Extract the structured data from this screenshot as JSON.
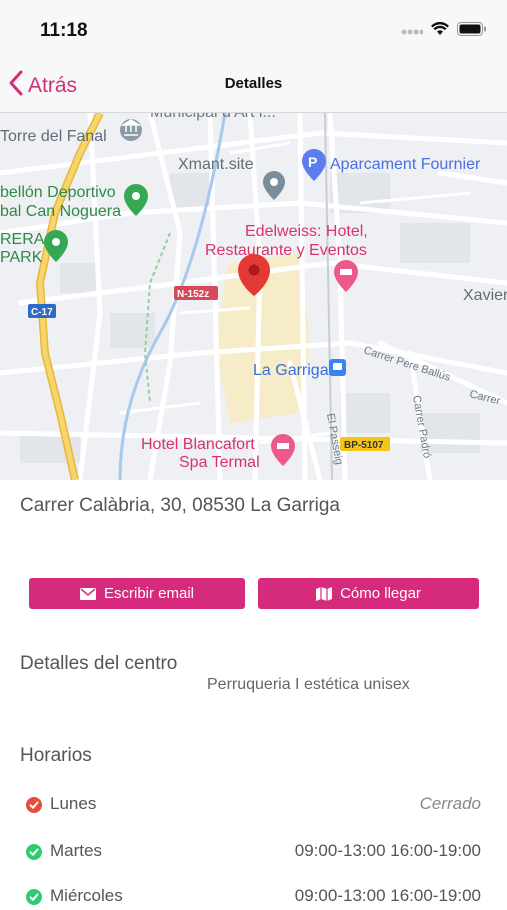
{
  "status": {
    "time": "11:18"
  },
  "nav": {
    "back_label": "Atrás",
    "title": "Detalles"
  },
  "map": {
    "labels": {
      "torre": "Torre del Fanal",
      "municipal": "Municipal d'Art i...",
      "xmant": "Xmant.site",
      "aparcament": "Aparcament Fournier",
      "pabellon1": "bellón Deportivo",
      "pabellon2": "bal Can Noguera",
      "rera": "RERA",
      "park": "PARK",
      "edelweiss1": "Edelweiss: Hotel,",
      "edelweiss2": "Restaurante y Eventos",
      "xavier": "Xavier",
      "n152": "N-152z",
      "c17": "C-17",
      "lagarriga": "La Garriga",
      "pereballus": "Carrer Pere Ballús",
      "carrer": "Carrer",
      "padro": "Carrer Padró",
      "passeig": "El Passeig",
      "bp5107": "BP-5107",
      "hotel1": "Hotel Blancafort",
      "hotel2": "Spa Termal"
    }
  },
  "address": "Carrer Calàbria, 30, 08530 La Garriga",
  "buttons": {
    "email": "Escribir email",
    "directions": "Cómo llegar"
  },
  "details": {
    "title": "Detalles del centro",
    "description": "Perruqueria I estética unisex"
  },
  "hours": {
    "title": "Horarios",
    "rows": [
      {
        "day": "Lunes",
        "time": "Cerrado",
        "status": "closed"
      },
      {
        "day": "Martes",
        "time": "09:00-13:00 16:00-19:00",
        "status": "open"
      },
      {
        "day": "Miércoles",
        "time": "09:00-13:00 16:00-19:00",
        "status": "open"
      }
    ]
  },
  "colors": {
    "accent": "#d62a7c",
    "open": "#2ecc71",
    "closed": "#e74c3c",
    "pin": "#e53935"
  }
}
